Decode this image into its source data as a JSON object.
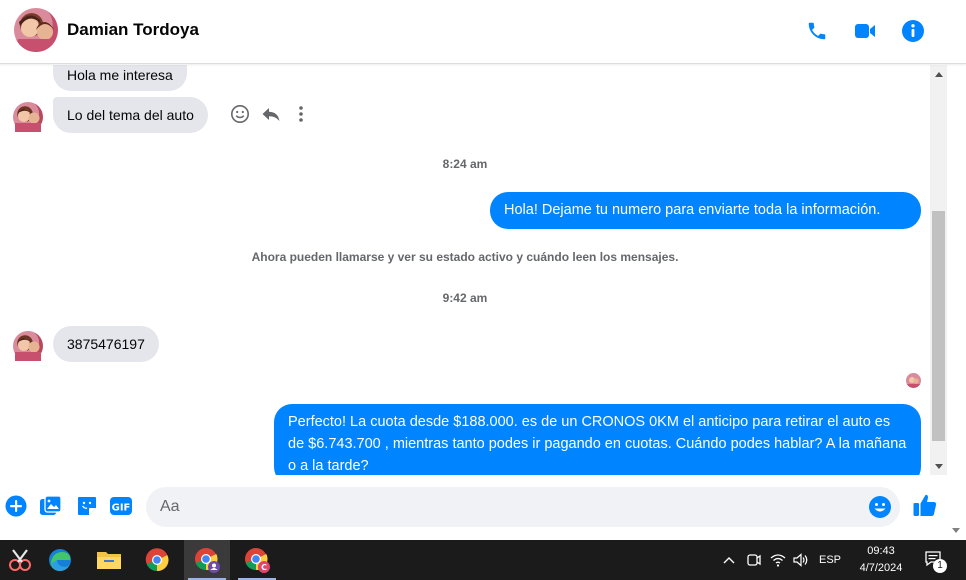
{
  "header": {
    "contact_name": "Damian Tordoya",
    "icons": [
      "phone-icon",
      "video-icon",
      "info-icon"
    ],
    "accent": "#0084ff"
  },
  "messages": {
    "in_1": "Hola me interesa",
    "in_2": "Lo del tema del auto",
    "time_1": "8:24 am",
    "out_1": "Hola! Dejame tu numero  para enviarte toda la información.",
    "system_note": "Ahora pueden llamarse y ver su estado activo y cuándo leen los mensajes.",
    "time_2": "9:42 am",
    "in_3": "3875476197",
    "out_2": "Perfecto! La cuota desde $188.000. es de un CRONOS 0KM el anticipo para retirar el auto es de $6.743.700 , mientras tanto podes ir pagando en cuotas. Cuándo podes hablar? A la mañana o a la tarde?"
  },
  "composer": {
    "placeholder": "Aa",
    "icons": [
      "plus-icon",
      "image-icon",
      "sticker-icon",
      "gif-icon",
      "emoji-icon",
      "like-icon"
    ]
  },
  "taskbar": {
    "language": "ESP",
    "time": "09:43",
    "date": "4/7/2024",
    "notification_count": "1",
    "apps": [
      "snipping-tool-icon",
      "edge-icon",
      "file-explorer-icon",
      "chrome-icon",
      "chrome-profile-icon",
      "chrome-profile-2-icon"
    ]
  }
}
